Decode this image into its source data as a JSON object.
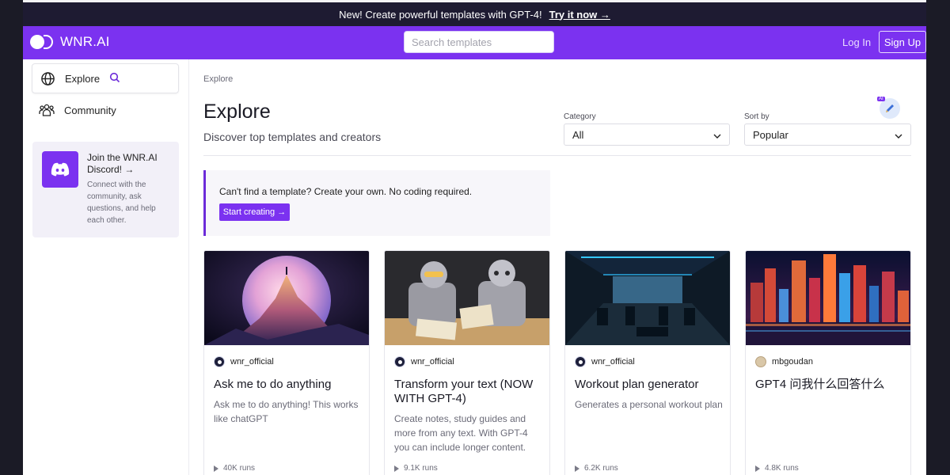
{
  "announcement": {
    "text": "New! Create powerful templates with GPT-4!",
    "link": "Try it now →"
  },
  "nav": {
    "brand": "WNR.AI",
    "search_placeholder": "Search templates",
    "login": "Log In",
    "signup": "Sign Up"
  },
  "sidebar": {
    "items": [
      {
        "label": "Explore",
        "icon": "globe-icon"
      },
      {
        "label": "Community",
        "icon": "people-icon"
      }
    ],
    "discord": {
      "title": "Join the WNR.AI Discord! →",
      "desc": "Connect with the community, ask questions, and help each other."
    }
  },
  "main": {
    "breadcrumb": "Explore",
    "title": "Explore",
    "subtitle": "Discover top templates and creators",
    "category": {
      "label": "Category",
      "value": "All"
    },
    "sort": {
      "label": "Sort by",
      "value": "Popular"
    },
    "banner": {
      "text": "Can't find a template? Create your own. No coding required.",
      "button": "Start creating →"
    },
    "cards": [
      {
        "author": "wnr_official",
        "title": "Ask me to do anything",
        "desc": "Ask me to do anything! This works like chatGPT",
        "runs": "40K runs"
      },
      {
        "author": "wnr_official",
        "title": "Transform your text (NOW WITH GPT-4)",
        "desc": "Create notes, study guides and more from any text. With GPT-4 you can include longer content.",
        "runs": "9.1K runs"
      },
      {
        "author": "wnr_official",
        "title": "Workout plan generator",
        "desc": "Generates a personal workout plan",
        "runs": "6.2K runs"
      },
      {
        "author": "mbgoudan",
        "title": "GPT4 问我什么回答什么",
        "desc": "",
        "runs": "4.8K runs"
      }
    ]
  },
  "colors": {
    "brand": "#7b32f0",
    "announce_bg": "#1e1b32"
  }
}
